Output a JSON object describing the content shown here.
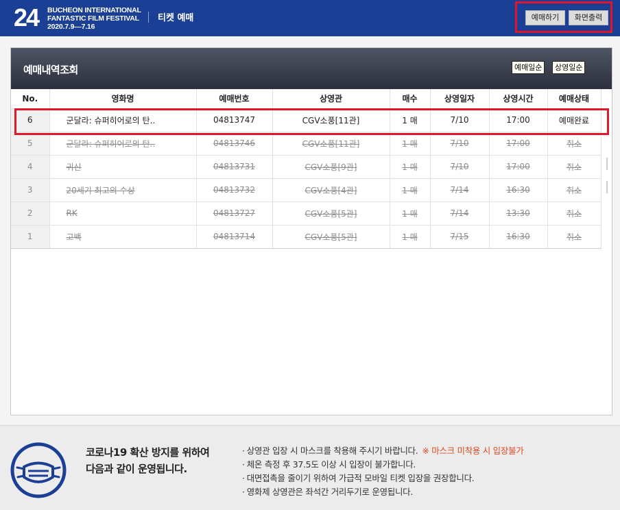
{
  "header": {
    "logo_number": "24",
    "logo_line1": "BUCHEON INTERNATIONAL",
    "logo_line2": "FANTASTIC FILM FESTIVAL",
    "logo_dates": "2020.7.9—7.16",
    "app_title": "티켓 예매",
    "buttons": {
      "book": "예매하기",
      "print": "화면출력"
    }
  },
  "panel": {
    "title": "예매내역조회",
    "sort": {
      "by_booking": "예매일순",
      "by_screening": "상영일순"
    }
  },
  "table": {
    "columns": [
      "No.",
      "영화명",
      "예매번호",
      "상영관",
      "매수",
      "상영일자",
      "상영시간",
      "예매상태"
    ],
    "rows": [
      {
        "no": "6",
        "title": "군달라: 슈퍼히어로의 탄..",
        "booking": "04813747",
        "venue": "CGV소풍[11관]",
        "tickets": "1 매",
        "date": "7/10",
        "time": "17:00",
        "status": "예매완료"
      },
      {
        "no": "5",
        "title": "군달라: 슈퍼히어로의 탄..",
        "booking": "04813746",
        "venue": "CGV소풍[11관]",
        "tickets": "1 매",
        "date": "7/10",
        "time": "17:00",
        "status": "취소"
      },
      {
        "no": "4",
        "title": "귀신",
        "booking": "04813731",
        "venue": "CGV소풍[9관]",
        "tickets": "1 매",
        "date": "7/10",
        "time": "17:00",
        "status": "취소"
      },
      {
        "no": "3",
        "title": "20세기 최고의 수상",
        "booking": "04813732",
        "venue": "CGV소풍[4관]",
        "tickets": "1 매",
        "date": "7/14",
        "time": "16:30",
        "status": "취소"
      },
      {
        "no": "2",
        "title": "RK",
        "booking": "04813727",
        "venue": "CGV소풍[5관]",
        "tickets": "1 매",
        "date": "7/14",
        "time": "13:30",
        "status": "취소"
      },
      {
        "no": "1",
        "title": "고백",
        "booking": "04813714",
        "venue": "CGV소풍[5관]",
        "tickets": "1 매",
        "date": "7/15",
        "time": "16:30",
        "status": "취소"
      }
    ]
  },
  "notice": {
    "icon": "mask-icon",
    "heading_line1": "코로나19 확산 방지를 위하여",
    "heading_line2": "다음과 같이 운영됩니다.",
    "items": [
      "상영관 입장 시 마스크를 착용해 주시기 바랍니다.",
      "체온 측정 후 37.5도 이상 시 입장이 불가합니다.",
      "대면접촉을 줄이기 위하여 가급적 모바일 티켓 입장을 권장합니다.",
      "영화제 상영관은 좌석간 거리두기로 운영됩니다."
    ],
    "warning": "※ 마스크 미착용 시 입장불가"
  },
  "colors": {
    "brand_blue": "#1b3f95",
    "highlight_red": "#e0162b",
    "warning_orange": "#e14a1f"
  }
}
